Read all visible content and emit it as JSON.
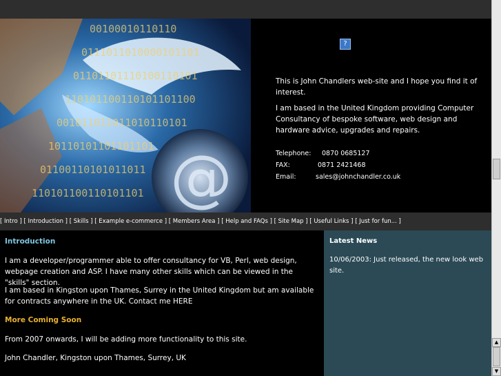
{
  "header": {
    "help_icon": "?",
    "intro_p1": "This is John Chandlers web-site and I hope you find it of interest.",
    "intro_p2": "I am based in the United Kingdom providing Computer Consultancy of bespoke software, web design and hardware advice, upgrades and repairs.",
    "contact": [
      {
        "label": "Telephone:",
        "value": "0870 0685127"
      },
      {
        "label": "FAX:",
        "value": "0871 2421468"
      },
      {
        "label": "Email:",
        "value": "sales@johnchandler.co.uk"
      }
    ],
    "hero_binary": [
      "00100010110110",
      "0111011010000101101",
      "01101101110100110101",
      "110101100110101101100",
      "001011011011010110101",
      "10110101101101101",
      "01100110101011011",
      "110101100110101101"
    ],
    "hero_at": "@"
  },
  "nav": [
    "[ Intro ]",
    "[ Introduction ]",
    "[ Skills ]",
    "[ Example e-commerce ]",
    "[ Members Area ]",
    "[ Help and FAQs ]",
    "[ Site Map ]",
    "[ Useful Links ]",
    "[ Just for fun... ]"
  ],
  "main": {
    "intro_heading": "Introduction",
    "p1": "I am a developer/programmer able to offer consultancy for VB, Perl, web design, webpage creation and ASP. I have many other skills which can be viewed in the \"skills\" section.",
    "p2": "I am based in Kingston upon Thames, Surrey in the United Kingdom but am available for contracts anywhere in the UK.  Contact me HERE",
    "more_heading": "More Coming Soon",
    "p3": "From 2007 onwards, I will be adding more functionality to this site.",
    "p4": "John Chandler, Kingston upon Thames, Surrey, UK"
  },
  "news": {
    "heading": "Latest News",
    "item": "10/06/2003:  Just released, the new look web site."
  },
  "colors": {
    "heading_main": "#7fc6e0",
    "heading_more": "#e8b030",
    "news_bg": "#2b4a55"
  }
}
